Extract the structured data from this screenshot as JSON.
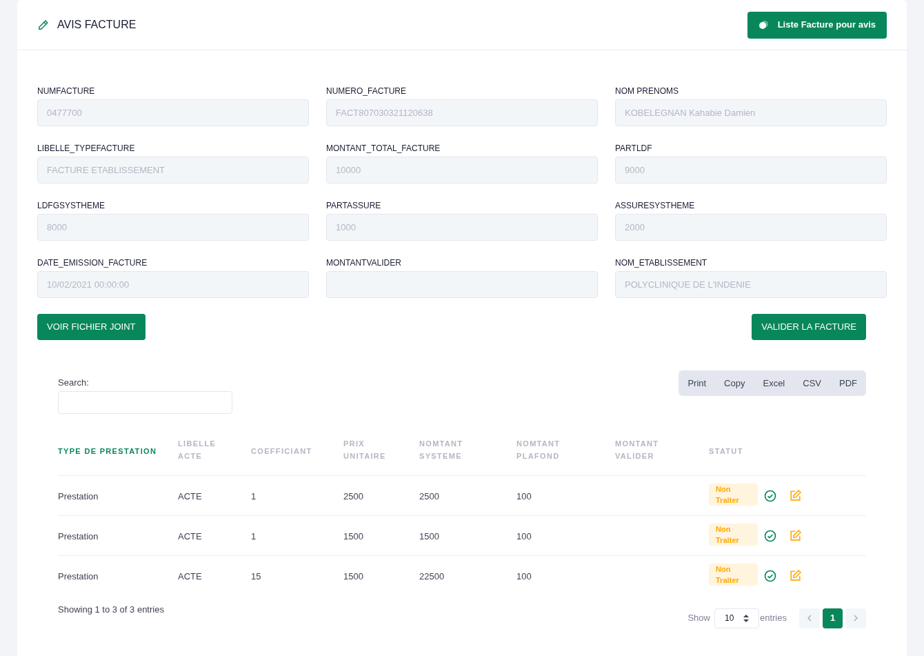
{
  "header": {
    "title": "AVIS FACTURE",
    "button": "Liste Facture pour avis"
  },
  "fields": [
    {
      "label": "NUMFACTURE",
      "value": "0477700"
    },
    {
      "label": "NUMERO_FACTURE",
      "value": "FACT807030321120638"
    },
    {
      "label": "NOM PRENOMS",
      "value": "KOBELEGNAN Kahabie Damien"
    },
    {
      "label": "LIBELLE_TYPEFACTURE",
      "value": "FACTURE ETABLISSEMENT"
    },
    {
      "label": "MONTANT_TOTAL_FACTURE",
      "value": "10000"
    },
    {
      "label": "PARTLDF",
      "value": "9000"
    },
    {
      "label": "LDFGSYSTHEME",
      "value": "8000"
    },
    {
      "label": "PARTASSURE",
      "value": "1000"
    },
    {
      "label": "ASSURESYSTHEME",
      "value": "2000"
    },
    {
      "label": "DATE_EMISSION_FACTURE",
      "value": "10/02/2021 00:00:00"
    },
    {
      "label": "MONTANTVALIDER"
    },
    {
      "label": "NOM_ETABLISSEMENT",
      "value": "POLYCLINIQUE DE L'INDENIE"
    }
  ],
  "actions": {
    "left": "VOIR FICHIER JOINT",
    "right": "VALIDER LA FACTURE"
  },
  "table": {
    "search_label": "Search:",
    "export_buttons": [
      "Print",
      "Copy",
      "Excel",
      "CSV",
      "PDF"
    ],
    "columns": [
      {
        "label": "TYPE DE PRESTATION",
        "selected": true
      },
      {
        "label": "LIBELLE ACTE",
        "selected": false
      },
      {
        "label": "COEFFICIANT",
        "selected": false
      },
      {
        "label": "PRIX UNITAIRE",
        "selected": false
      },
      {
        "label": "NOMTANT SYSTEME",
        "selected": false
      },
      {
        "label": "NOMTANT PLAFOND",
        "selected": false
      },
      {
        "label": "MONTANT VALIDER",
        "selected": false
      },
      {
        "label": "STATUT",
        "selected": false
      }
    ],
    "rows": [
      {
        "cells": [
          "Prestation",
          "ACTE",
          "1",
          "2500",
          "2500",
          "100"
        ],
        "status": "Non Traiter"
      },
      {
        "cells": [
          "Prestation",
          "ACTE",
          "1",
          "1500",
          "1500",
          "100"
        ],
        "status": "Non Traiter"
      },
      {
        "cells": [
          "Prestation",
          "ACTE",
          "15",
          "1500",
          "22500",
          "100"
        ],
        "status": "Non Traiter"
      }
    ],
    "info": "Showing 1 to 3 of 3 entries",
    "show_label": "Show",
    "page_size": "10",
    "entries_label": "entries",
    "pages": [
      {
        "label": "1",
        "selected": true
      }
    ]
  }
}
